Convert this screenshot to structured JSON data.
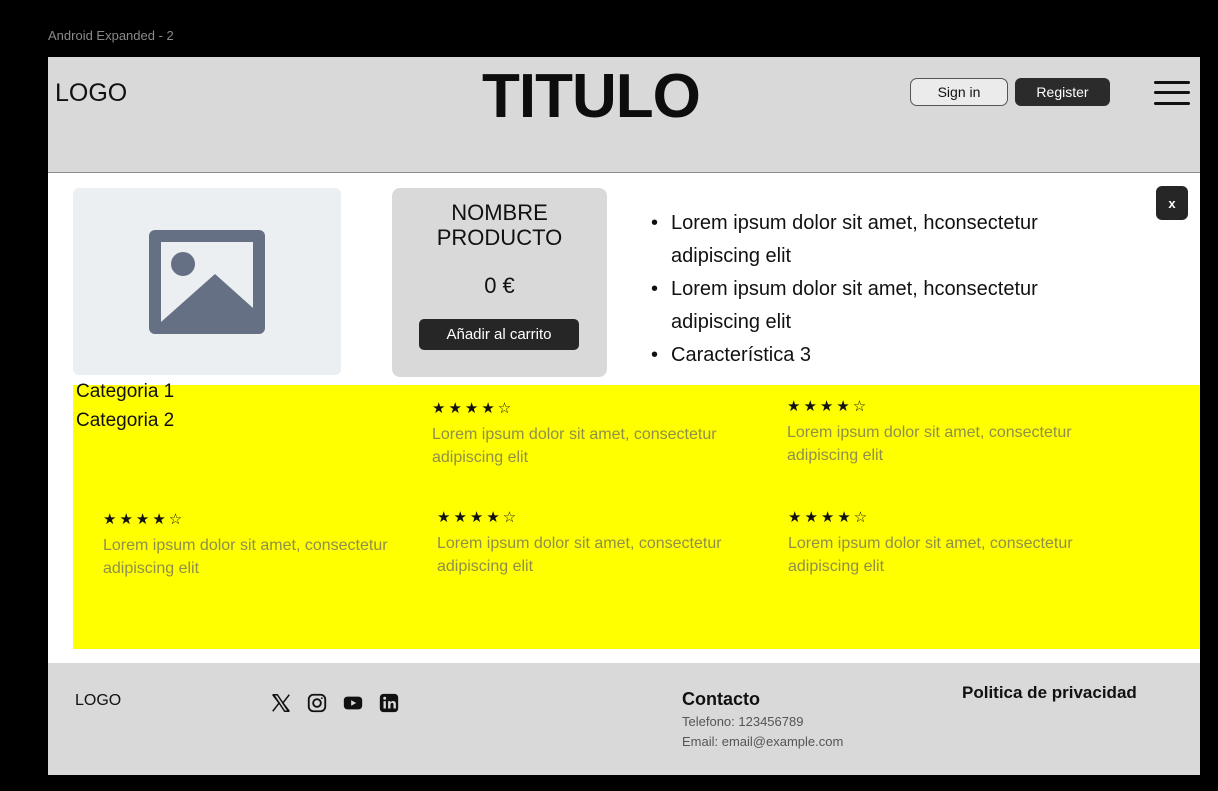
{
  "frame": {
    "label": "Android Expanded - 2"
  },
  "header": {
    "logo": "LOGO",
    "title": "TITULO",
    "signin_label": "Sign in",
    "register_label": "Register",
    "menu_icon": "hamburger-icon"
  },
  "product": {
    "image_icon": "image-placeholder-icon",
    "name": "NOMBRE PRODUCTO",
    "price": "0 €",
    "add_to_cart_label": "Añadir al carrito",
    "features": [
      "Lorem ipsum dolor sit amet, hconsectetur adipiscing elit",
      "Lorem ipsum dolor sit amet, hconsectetur adipiscing elit",
      "Característica 3"
    ],
    "close_label": "x"
  },
  "reviews": {
    "categories": [
      "Categoria 1",
      "Categoria 2"
    ],
    "items": [
      {
        "stars": "★★★★☆",
        "rating": 4,
        "text": "Lorem ipsum dolor sit amet, consectetur adipiscing elit"
      },
      {
        "stars": "★★★★☆",
        "rating": 4,
        "text": "Lorem ipsum dolor sit amet, consectetur adipiscing elit"
      },
      {
        "stars": "★★★★☆",
        "rating": 4,
        "text": "Lorem ipsum dolor sit amet, consectetur adipiscing elit"
      },
      {
        "stars": "★★★★☆",
        "rating": 4,
        "text": "Lorem ipsum dolor sit amet, consectetur adipiscing elit"
      },
      {
        "stars": "★★★★☆",
        "rating": 4,
        "text": "Lorem ipsum dolor sit amet, consectetur adipiscing elit"
      }
    ],
    "background_color": "#ffff00"
  },
  "footer": {
    "logo": "LOGO",
    "socials": [
      "x-icon",
      "instagram-icon",
      "youtube-icon",
      "linkedin-icon"
    ],
    "contact_title": "Contacto",
    "phone": "Telefono:  123456789",
    "email": "Email: email@example.com",
    "privacy_label": "Politica de privacidad"
  }
}
